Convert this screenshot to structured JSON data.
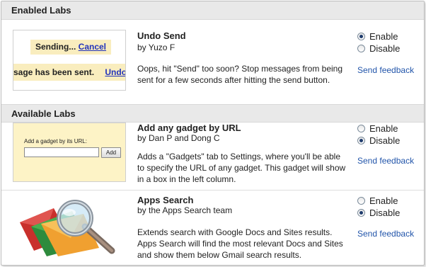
{
  "enabled_labs": {
    "header": "Enabled Labs",
    "items": [
      {
        "title": "Undo Send",
        "author": "by Yuzo F",
        "description": "Oops, hit \"Send\" too soon? Stop messages from being sent for a few seconds after hitting the send button.",
        "enable_label": "Enable",
        "disable_label": "Disable",
        "selected": "Enable",
        "feedback": "Send feedback",
        "thumb": {
          "sending_text": "Sending...",
          "cancel_link": "Cancel",
          "sent_text": "sage has been sent.",
          "undo_link": "Undo"
        }
      }
    ]
  },
  "available_labs": {
    "header": "Available Labs",
    "items": [
      {
        "title": "Add any gadget by URL",
        "author": "by Dan P and Dong C",
        "description": "Adds a \"Gadgets\" tab to Settings, where you'll be able to specify the URL of any gadget. This gadget will show in a box in the left column.",
        "enable_label": "Enable",
        "disable_label": "Disable",
        "selected": "Disable",
        "feedback": "Send feedback",
        "thumb": {
          "label": "Add a gadget by its URL:",
          "button": "Add"
        }
      },
      {
        "title": "Apps Search",
        "author": "by the Apps Search team",
        "description": "Extends search with Google Docs and Sites results. Apps Search will find the most relevant Docs and Sites and show them below Gmail search results.",
        "enable_label": "Enable",
        "disable_label": "Disable",
        "selected": "Disable",
        "feedback": "Send feedback",
        "thumb": {
          "icon": "envelope-magnifier-icon"
        }
      }
    ]
  },
  "colors": {
    "link": "#2255aa",
    "highlight": "#f9edbe",
    "header_bg": "#e9e9e9"
  }
}
